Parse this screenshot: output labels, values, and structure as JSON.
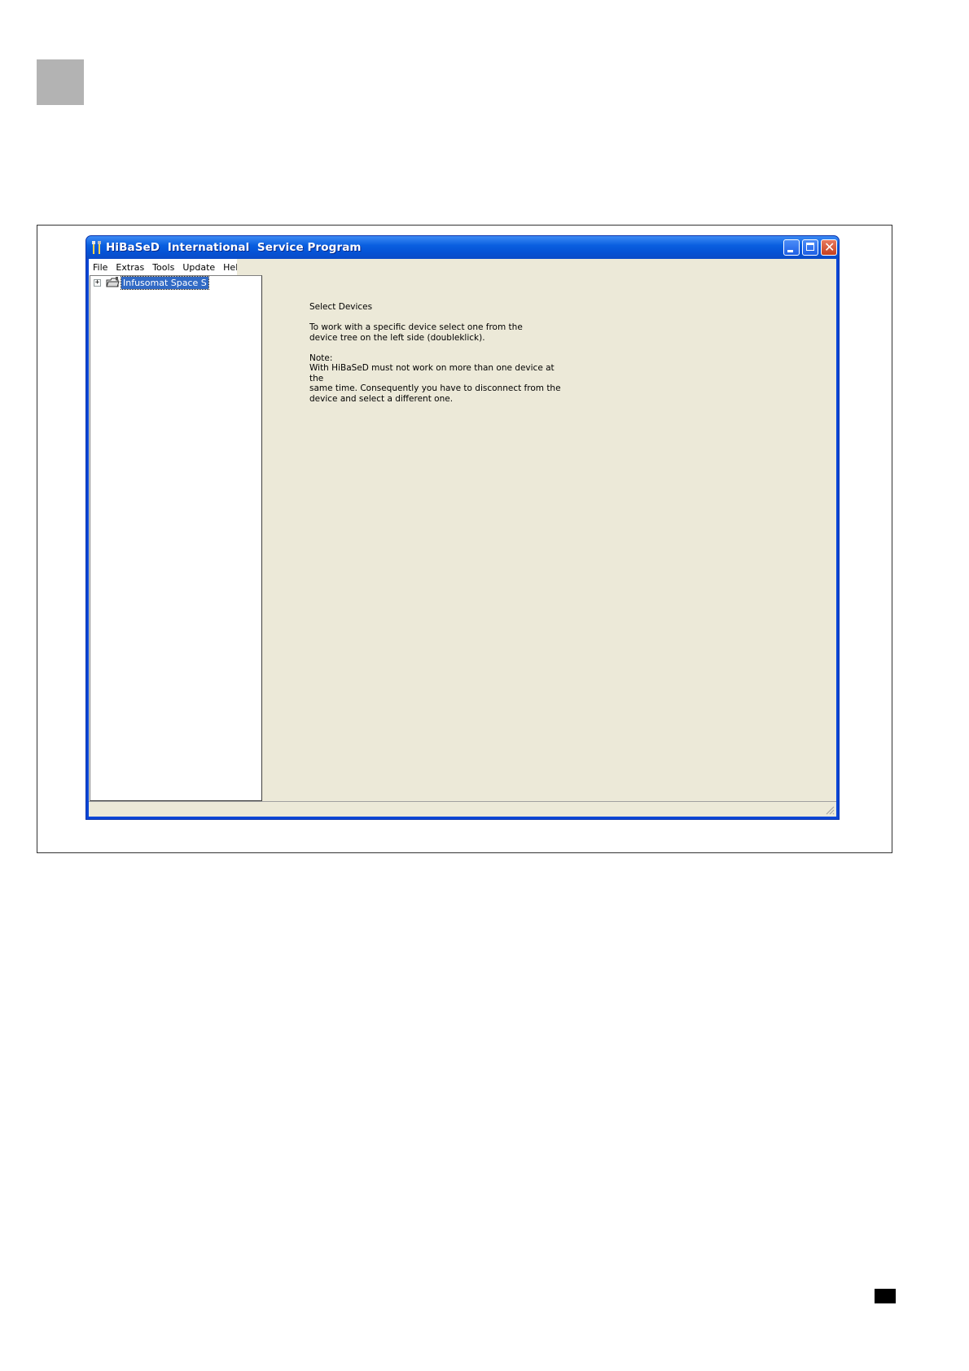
{
  "window": {
    "title": "HiBaSeD  International  Service Program",
    "controls": {
      "minimize": "minimize",
      "maximize": "maximize",
      "close": "close"
    }
  },
  "menu": {
    "items": [
      {
        "label": "File"
      },
      {
        "label": "Extras"
      },
      {
        "label": "Tools"
      },
      {
        "label": "Update"
      },
      {
        "label": "Help"
      }
    ]
  },
  "tree": {
    "expander": "+",
    "items": [
      {
        "label": "Infusomat Space S",
        "selected": true,
        "icon": "device-folder-icon"
      }
    ]
  },
  "info": {
    "heading": "Select Devices",
    "line1": "To work with a specific device select one from the",
    "line2": "device tree on the left side (doubleklick).",
    "note_label": "Note:",
    "note1": "With HiBaSeD must not work on more than one device at the",
    "note2": "same time. Consequently you have to disconnect from the",
    "note3": "device and select a different one."
  },
  "colors": {
    "titlebar": "#0553d6",
    "selection": "#316ac5",
    "client_bg": "#ece9d8",
    "close_button": "#c6401f"
  }
}
